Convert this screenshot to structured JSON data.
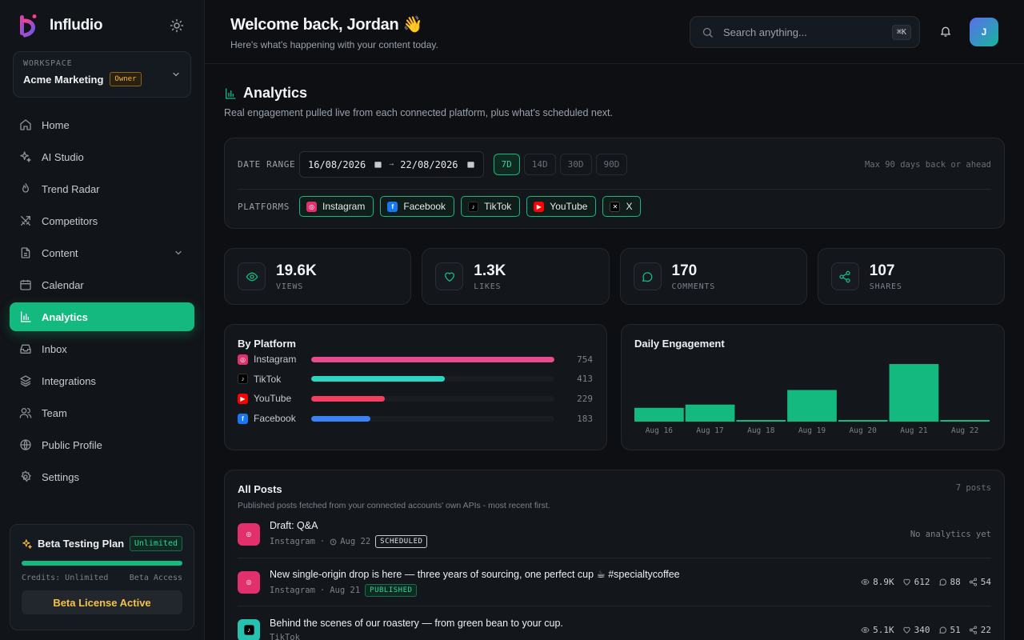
{
  "brand": {
    "name": "Infludio"
  },
  "workspace": {
    "label": "WORKSPACE",
    "name": "Acme Marketing",
    "role": "Owner"
  },
  "nav": {
    "items": [
      {
        "label": "Home"
      },
      {
        "label": "AI Studio"
      },
      {
        "label": "Trend Radar"
      },
      {
        "label": "Competitors"
      },
      {
        "label": "Content"
      },
      {
        "label": "Calendar"
      },
      {
        "label": "Analytics"
      },
      {
        "label": "Inbox"
      },
      {
        "label": "Integrations"
      },
      {
        "label": "Team"
      },
      {
        "label": "Public Profile"
      },
      {
        "label": "Settings"
      }
    ],
    "active": "Analytics"
  },
  "plan": {
    "title": "Beta Testing Plan",
    "badge": "Unlimited",
    "progress": 1.0,
    "credits": "Credits: Unlimited",
    "access": "Beta Access",
    "button": "Beta License Active"
  },
  "header": {
    "welcome": "Welcome back, Jordan 👋",
    "subtitle": "Here's what's happening with your content today.",
    "search_placeholder": "Search anything...",
    "shortcut": "⌘K",
    "avatar_initial": "J"
  },
  "page": {
    "title": "Analytics",
    "subtitle": "Real engagement pulled live from each connected platform, plus what's scheduled next."
  },
  "filters": {
    "date_label": "DATE RANGE",
    "date_from": "16/08/2026",
    "date_to": "22/08/2026",
    "ranges": [
      "7D",
      "14D",
      "30D",
      "90D"
    ],
    "active_range": "7D",
    "note": "Max 90 days back or ahead",
    "platform_label": "PLATFORMS",
    "platforms": [
      "Instagram",
      "Facebook",
      "TikTok",
      "YouTube",
      "X"
    ]
  },
  "stats": [
    {
      "value": "19.6K",
      "label": "VIEWS"
    },
    {
      "value": "1.3K",
      "label": "LIKES"
    },
    {
      "value": "170",
      "label": "COMMENTS"
    },
    {
      "value": "107",
      "label": "SHARES"
    }
  ],
  "by_platform": {
    "title": "By Platform",
    "rows": [
      {
        "name": "Instagram",
        "value": 754,
        "color": "#e84c8f"
      },
      {
        "name": "TikTok",
        "value": 413,
        "color": "#2dd4bf"
      },
      {
        "name": "YouTube",
        "value": 229,
        "color": "#f43f5e"
      },
      {
        "name": "Facebook",
        "value": 183,
        "color": "#3b82f6"
      }
    ],
    "max": 754
  },
  "chart_data": {
    "type": "bar",
    "title": "Daily Engagement",
    "categories": [
      "Aug 16",
      "Aug 17",
      "Aug 18",
      "Aug 19",
      "Aug 20",
      "Aug 21",
      "Aug 22"
    ],
    "values": [
      17,
      21,
      2,
      39,
      2,
      71,
      2
    ],
    "ylim": [
      0,
      75
    ],
    "color": "#13b97e",
    "grid": false
  },
  "posts": {
    "title": "All Posts",
    "count": "7 posts",
    "subtitle": "Published posts fetched from your connected accounts' own APIs - most recent first.",
    "items": [
      {
        "title": "Draft: Q&A",
        "platform": "Instagram",
        "date": "Aug 22",
        "status": "SCHEDULED",
        "scheduled": true,
        "no_analytics": "No analytics yet"
      },
      {
        "title": "New single-origin drop is here — three years of sourcing, one perfect cup ☕ #specialtycoffee",
        "platform": "Instagram",
        "date": "Aug 21",
        "status": "PUBLISHED",
        "views": "8.9K",
        "likes": "612",
        "comments": "88",
        "shares": "54"
      },
      {
        "title": "Behind the scenes of our roastery — from green bean to your cup.",
        "platform": "TikTok",
        "date": "",
        "status": "",
        "views": "5.1K",
        "likes": "340",
        "comments": "51",
        "shares": "22"
      }
    ]
  }
}
